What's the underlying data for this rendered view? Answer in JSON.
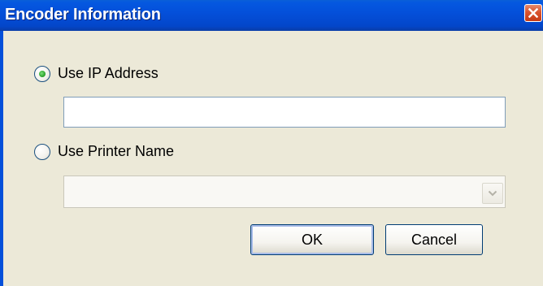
{
  "window": {
    "title": "Encoder Information",
    "close_icon": "close-icon",
    "accent_color": "#0450DA"
  },
  "options": {
    "ip_address": {
      "label": "Use IP Address",
      "selected": true,
      "value": "",
      "placeholder": ""
    },
    "printer_name": {
      "label": "Use Printer Name",
      "selected": false,
      "value": ""
    }
  },
  "buttons": {
    "ok": "OK",
    "cancel": "Cancel"
  }
}
